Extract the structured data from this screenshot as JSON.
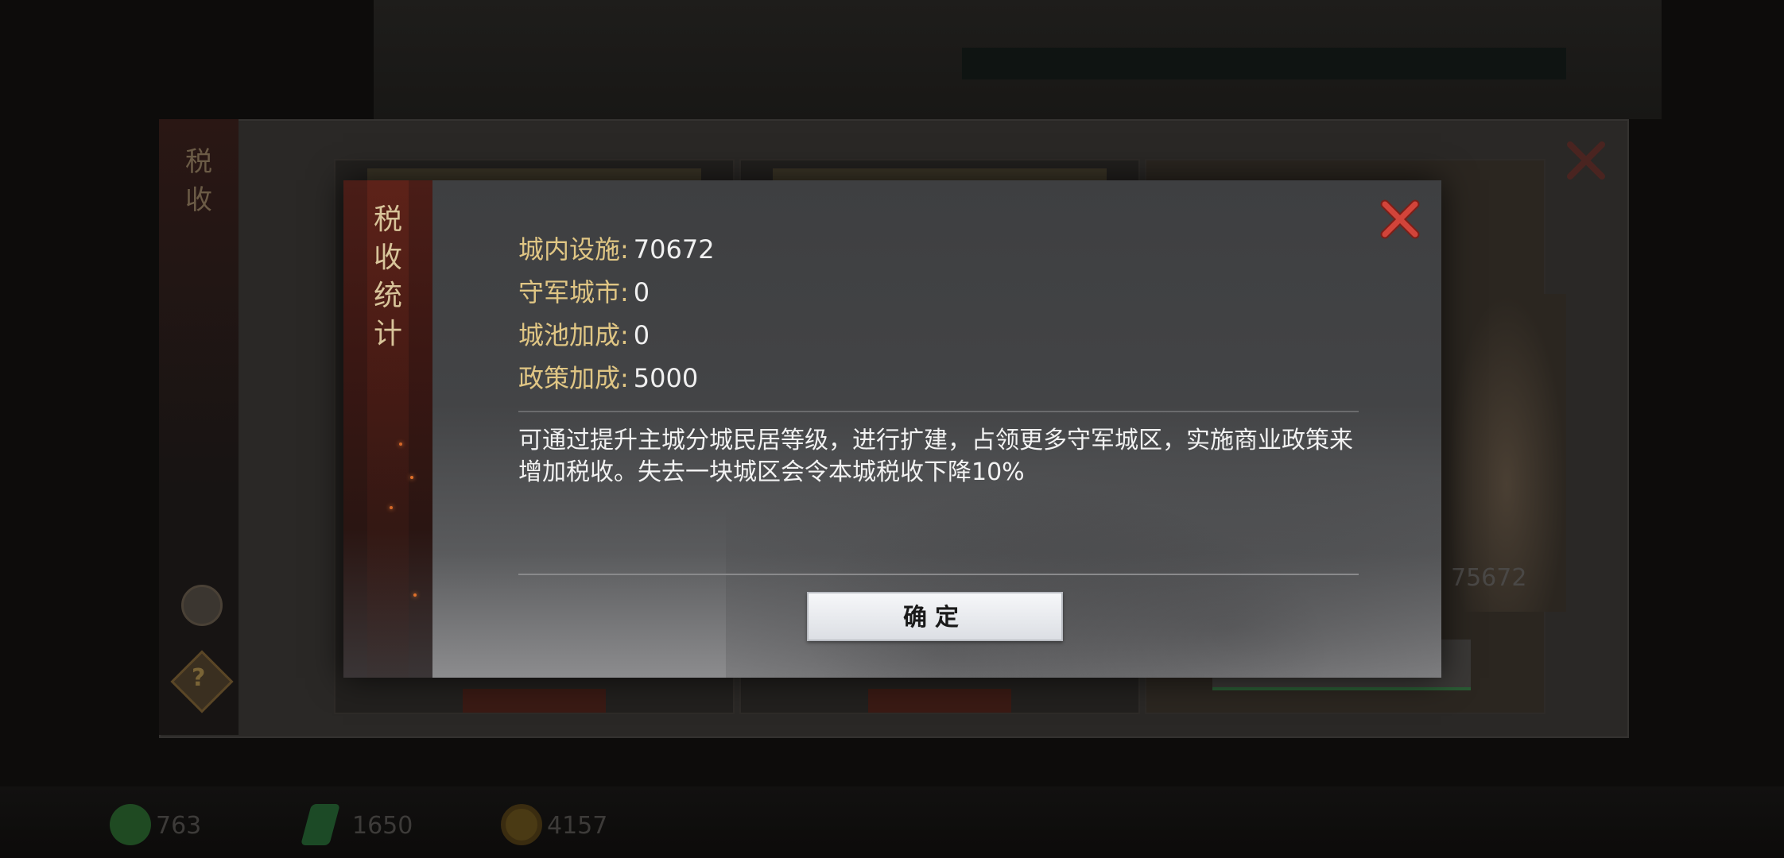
{
  "background": {
    "sidebar_title": "税收",
    "resources": [
      {
        "name": "resource-1",
        "value": "763"
      },
      {
        "name": "resource-2",
        "value": "1650"
      },
      {
        "name": "resource-3",
        "value": "4157"
      }
    ],
    "card_value": "75672"
  },
  "dialog": {
    "title_chars": [
      "税",
      "收",
      "统",
      "计"
    ],
    "stats": [
      {
        "label": "城内设施",
        "value": "70672"
      },
      {
        "label": "守军城市",
        "value": "0"
      },
      {
        "label": "城池加成",
        "value": "0"
      },
      {
        "label": "政策加成",
        "value": "5000"
      }
    ],
    "separator": ":",
    "description": "可通过提升主城分城民居等级，进行扩建，占领更多守军城区，实施商业政策来增加税收。失去一块城区会令本城税收下降10%",
    "confirm_label": "确定",
    "close_icon": "close-icon"
  },
  "colors": {
    "label_gold": "#e0c684",
    "value_white": "#f0f0f0",
    "close_red": "#c0392b",
    "ribbon_red": "#4a1d17"
  }
}
